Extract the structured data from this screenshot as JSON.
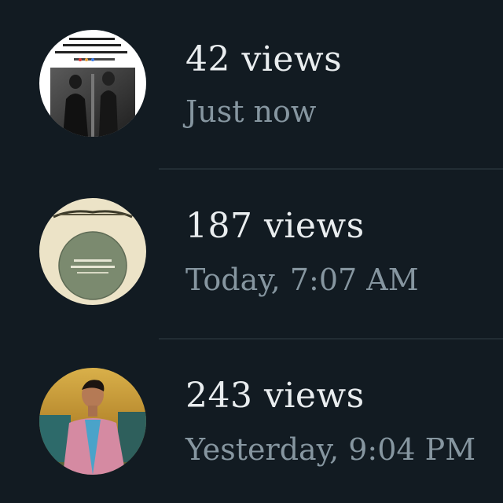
{
  "status_views": [
    {
      "views": "42 views",
      "time": "Just now",
      "thumb_icon": "urdu-poetry-photo-thumbnail"
    },
    {
      "views": "187 views",
      "time": "Today, 7:07 AM",
      "thumb_icon": "calligraphy-thumbnail"
    },
    {
      "views": "243 views",
      "time": "Yesterday, 9:04 PM",
      "thumb_icon": "person-photo-thumbnail"
    }
  ],
  "colors": {
    "background": "#121b22",
    "primary_text": "#e9edef",
    "secondary_text": "#8696a0",
    "divider": "#222d34"
  }
}
